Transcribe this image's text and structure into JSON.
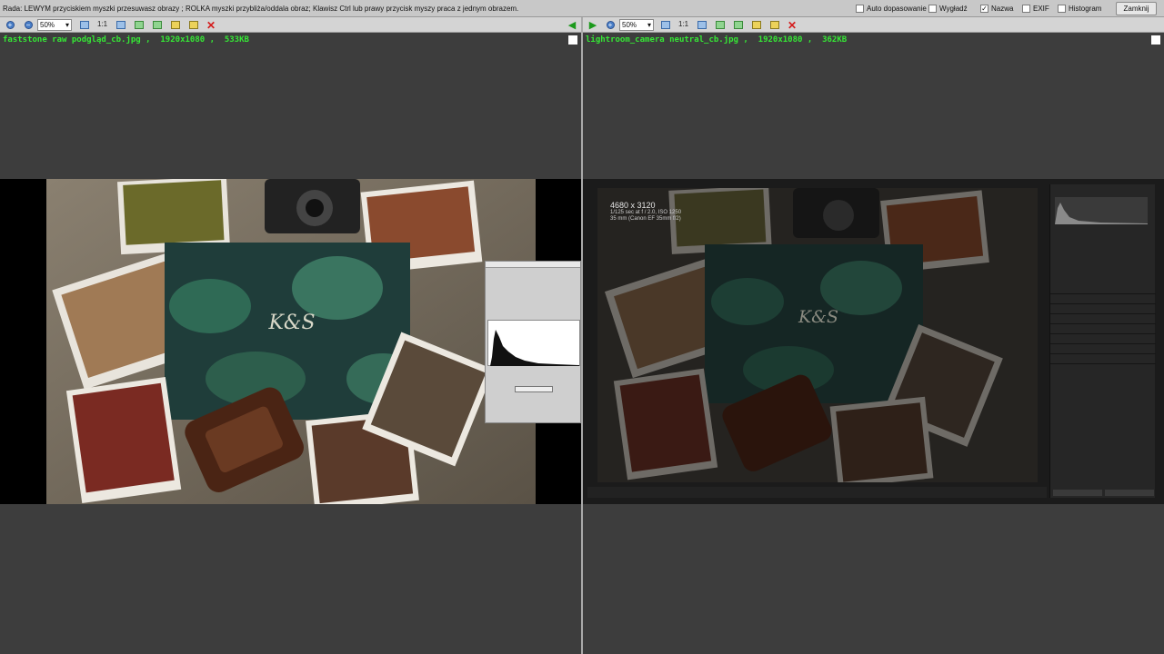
{
  "hint": {
    "text": "Rada: LEWYM przyciskiem myszki przesuwasz obrazy ; ROLKA myszki przybliża/oddala obraz; Klawisz Ctrl lub prawy przycisk myszy praca z jednym obrazem."
  },
  "options": {
    "auto_fit": {
      "label": "Auto dopasowanie",
      "checked": false
    },
    "smooth": {
      "label": "Wygładź",
      "checked": false
    },
    "name": {
      "label": "Nazwa",
      "checked": true
    },
    "exif": {
      "label": "EXIF",
      "checked": false
    },
    "histogram": {
      "label": "Histogram",
      "checked": false
    }
  },
  "close_label": "Zamknij",
  "left": {
    "zoom": "50%",
    "ratio": "1:1",
    "filename": "faststone raw podgląd_cb.jpg ,  1920x1080 ,  533KB"
  },
  "right": {
    "zoom": "50%",
    "ratio": "1:1",
    "filename": "lightroom_camera neutral_cb.jpg ,  1920x1080 ,  362KB",
    "lr_dimensions": "4680 x 3120",
    "lr_exposure": "1/125 sec at f / 2.0, ISO 1250",
    "lr_lens": "35 mm (Canon EF 35mm f/2)"
  },
  "colors": {
    "filename_green": "#35e835",
    "close_red": "#d41b1b",
    "panel_bg": "#3d3d3d"
  }
}
